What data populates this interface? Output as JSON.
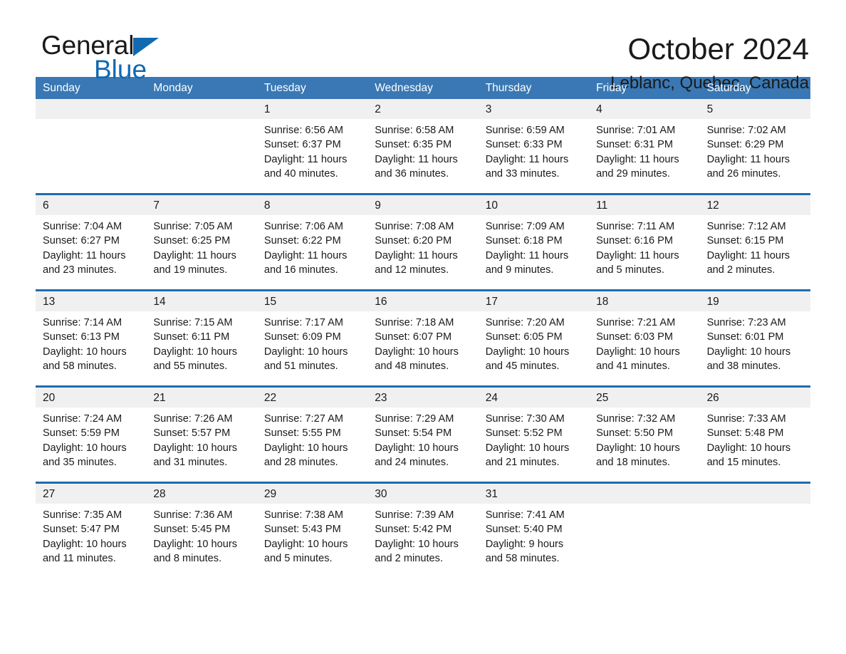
{
  "brand": {
    "name_part1": "General",
    "name_part2": "Blue",
    "triangle_color": "#1269b0"
  },
  "header": {
    "month_title": "October 2024",
    "location": "Leblanc, Quebec, Canada",
    "header_bar_color": "#3978b4",
    "week_rule_color": "#1f6bb0",
    "daynum_band_color": "#f0f0f0"
  },
  "weekday_names": [
    "Sunday",
    "Monday",
    "Tuesday",
    "Wednesday",
    "Thursday",
    "Friday",
    "Saturday"
  ],
  "weeks": [
    {
      "days": [
        {
          "num": "",
          "sunrise": "",
          "sunset": "",
          "daylight_line1": "",
          "daylight_line2": ""
        },
        {
          "num": "",
          "sunrise": "",
          "sunset": "",
          "daylight_line1": "",
          "daylight_line2": ""
        },
        {
          "num": "1",
          "sunrise": "Sunrise: 6:56 AM",
          "sunset": "Sunset: 6:37 PM",
          "daylight_line1": "Daylight: 11 hours",
          "daylight_line2": "and 40 minutes."
        },
        {
          "num": "2",
          "sunrise": "Sunrise: 6:58 AM",
          "sunset": "Sunset: 6:35 PM",
          "daylight_line1": "Daylight: 11 hours",
          "daylight_line2": "and 36 minutes."
        },
        {
          "num": "3",
          "sunrise": "Sunrise: 6:59 AM",
          "sunset": "Sunset: 6:33 PM",
          "daylight_line1": "Daylight: 11 hours",
          "daylight_line2": "and 33 minutes."
        },
        {
          "num": "4",
          "sunrise": "Sunrise: 7:01 AM",
          "sunset": "Sunset: 6:31 PM",
          "daylight_line1": "Daylight: 11 hours",
          "daylight_line2": "and 29 minutes."
        },
        {
          "num": "5",
          "sunrise": "Sunrise: 7:02 AM",
          "sunset": "Sunset: 6:29 PM",
          "daylight_line1": "Daylight: 11 hours",
          "daylight_line2": "and 26 minutes."
        }
      ]
    },
    {
      "days": [
        {
          "num": "6",
          "sunrise": "Sunrise: 7:04 AM",
          "sunset": "Sunset: 6:27 PM",
          "daylight_line1": "Daylight: 11 hours",
          "daylight_line2": "and 23 minutes."
        },
        {
          "num": "7",
          "sunrise": "Sunrise: 7:05 AM",
          "sunset": "Sunset: 6:25 PM",
          "daylight_line1": "Daylight: 11 hours",
          "daylight_line2": "and 19 minutes."
        },
        {
          "num": "8",
          "sunrise": "Sunrise: 7:06 AM",
          "sunset": "Sunset: 6:22 PM",
          "daylight_line1": "Daylight: 11 hours",
          "daylight_line2": "and 16 minutes."
        },
        {
          "num": "9",
          "sunrise": "Sunrise: 7:08 AM",
          "sunset": "Sunset: 6:20 PM",
          "daylight_line1": "Daylight: 11 hours",
          "daylight_line2": "and 12 minutes."
        },
        {
          "num": "10",
          "sunrise": "Sunrise: 7:09 AM",
          "sunset": "Sunset: 6:18 PM",
          "daylight_line1": "Daylight: 11 hours",
          "daylight_line2": "and 9 minutes."
        },
        {
          "num": "11",
          "sunrise": "Sunrise: 7:11 AM",
          "sunset": "Sunset: 6:16 PM",
          "daylight_line1": "Daylight: 11 hours",
          "daylight_line2": "and 5 minutes."
        },
        {
          "num": "12",
          "sunrise": "Sunrise: 7:12 AM",
          "sunset": "Sunset: 6:15 PM",
          "daylight_line1": "Daylight: 11 hours",
          "daylight_line2": "and 2 minutes."
        }
      ]
    },
    {
      "days": [
        {
          "num": "13",
          "sunrise": "Sunrise: 7:14 AM",
          "sunset": "Sunset: 6:13 PM",
          "daylight_line1": "Daylight: 10 hours",
          "daylight_line2": "and 58 minutes."
        },
        {
          "num": "14",
          "sunrise": "Sunrise: 7:15 AM",
          "sunset": "Sunset: 6:11 PM",
          "daylight_line1": "Daylight: 10 hours",
          "daylight_line2": "and 55 minutes."
        },
        {
          "num": "15",
          "sunrise": "Sunrise: 7:17 AM",
          "sunset": "Sunset: 6:09 PM",
          "daylight_line1": "Daylight: 10 hours",
          "daylight_line2": "and 51 minutes."
        },
        {
          "num": "16",
          "sunrise": "Sunrise: 7:18 AM",
          "sunset": "Sunset: 6:07 PM",
          "daylight_line1": "Daylight: 10 hours",
          "daylight_line2": "and 48 minutes."
        },
        {
          "num": "17",
          "sunrise": "Sunrise: 7:20 AM",
          "sunset": "Sunset: 6:05 PM",
          "daylight_line1": "Daylight: 10 hours",
          "daylight_line2": "and 45 minutes."
        },
        {
          "num": "18",
          "sunrise": "Sunrise: 7:21 AM",
          "sunset": "Sunset: 6:03 PM",
          "daylight_line1": "Daylight: 10 hours",
          "daylight_line2": "and 41 minutes."
        },
        {
          "num": "19",
          "sunrise": "Sunrise: 7:23 AM",
          "sunset": "Sunset: 6:01 PM",
          "daylight_line1": "Daylight: 10 hours",
          "daylight_line2": "and 38 minutes."
        }
      ]
    },
    {
      "days": [
        {
          "num": "20",
          "sunrise": "Sunrise: 7:24 AM",
          "sunset": "Sunset: 5:59 PM",
          "daylight_line1": "Daylight: 10 hours",
          "daylight_line2": "and 35 minutes."
        },
        {
          "num": "21",
          "sunrise": "Sunrise: 7:26 AM",
          "sunset": "Sunset: 5:57 PM",
          "daylight_line1": "Daylight: 10 hours",
          "daylight_line2": "and 31 minutes."
        },
        {
          "num": "22",
          "sunrise": "Sunrise: 7:27 AM",
          "sunset": "Sunset: 5:55 PM",
          "daylight_line1": "Daylight: 10 hours",
          "daylight_line2": "and 28 minutes."
        },
        {
          "num": "23",
          "sunrise": "Sunrise: 7:29 AM",
          "sunset": "Sunset: 5:54 PM",
          "daylight_line1": "Daylight: 10 hours",
          "daylight_line2": "and 24 minutes."
        },
        {
          "num": "24",
          "sunrise": "Sunrise: 7:30 AM",
          "sunset": "Sunset: 5:52 PM",
          "daylight_line1": "Daylight: 10 hours",
          "daylight_line2": "and 21 minutes."
        },
        {
          "num": "25",
          "sunrise": "Sunrise: 7:32 AM",
          "sunset": "Sunset: 5:50 PM",
          "daylight_line1": "Daylight: 10 hours",
          "daylight_line2": "and 18 minutes."
        },
        {
          "num": "26",
          "sunrise": "Sunrise: 7:33 AM",
          "sunset": "Sunset: 5:48 PM",
          "daylight_line1": "Daylight: 10 hours",
          "daylight_line2": "and 15 minutes."
        }
      ]
    },
    {
      "days": [
        {
          "num": "27",
          "sunrise": "Sunrise: 7:35 AM",
          "sunset": "Sunset: 5:47 PM",
          "daylight_line1": "Daylight: 10 hours",
          "daylight_line2": "and 11 minutes."
        },
        {
          "num": "28",
          "sunrise": "Sunrise: 7:36 AM",
          "sunset": "Sunset: 5:45 PM",
          "daylight_line1": "Daylight: 10 hours",
          "daylight_line2": "and 8 minutes."
        },
        {
          "num": "29",
          "sunrise": "Sunrise: 7:38 AM",
          "sunset": "Sunset: 5:43 PM",
          "daylight_line1": "Daylight: 10 hours",
          "daylight_line2": "and 5 minutes."
        },
        {
          "num": "30",
          "sunrise": "Sunrise: 7:39 AM",
          "sunset": "Sunset: 5:42 PM",
          "daylight_line1": "Daylight: 10 hours",
          "daylight_line2": "and 2 minutes."
        },
        {
          "num": "31",
          "sunrise": "Sunrise: 7:41 AM",
          "sunset": "Sunset: 5:40 PM",
          "daylight_line1": "Daylight: 9 hours",
          "daylight_line2": "and 58 minutes."
        },
        {
          "num": "",
          "sunrise": "",
          "sunset": "",
          "daylight_line1": "",
          "daylight_line2": ""
        },
        {
          "num": "",
          "sunrise": "",
          "sunset": "",
          "daylight_line1": "",
          "daylight_line2": ""
        }
      ]
    }
  ]
}
